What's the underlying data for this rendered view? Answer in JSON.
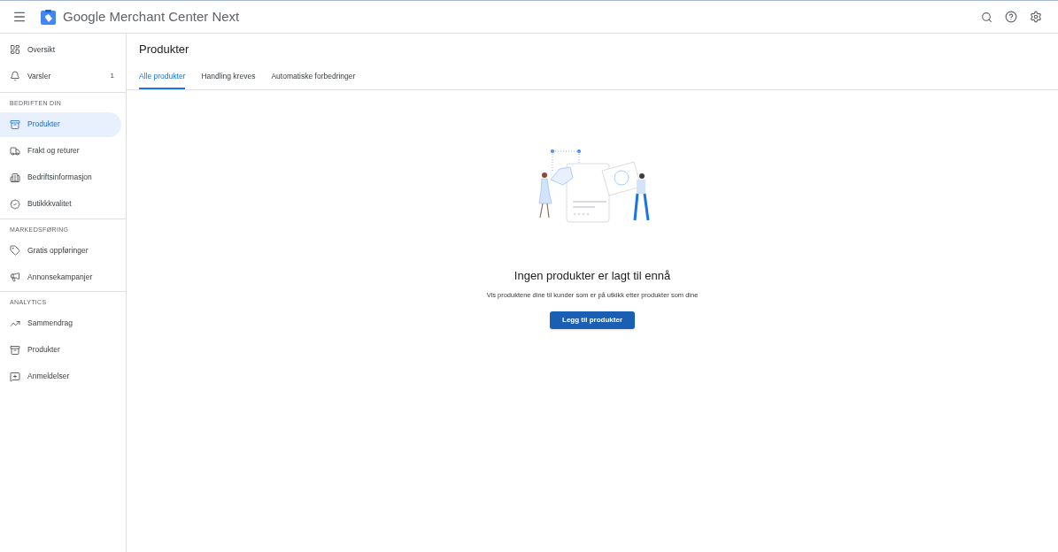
{
  "header": {
    "title": "Google Merchant Center Next"
  },
  "sidebar": {
    "sections": [
      {
        "items": [
          {
            "label": "Oversikt",
            "selected": false
          },
          {
            "label": "Varsler",
            "badge": "1",
            "selected": false
          }
        ]
      },
      {
        "heading": "BEDRIFTEN DIN",
        "items": [
          {
            "label": "Produkter",
            "selected": true
          },
          {
            "label": "Frakt og returer",
            "selected": false
          },
          {
            "label": "Bedriftsinformasjon",
            "selected": false
          },
          {
            "label": "Butikkkvalitet",
            "selected": false
          }
        ]
      },
      {
        "heading": "MARKEDSFØRING",
        "items": [
          {
            "label": "Gratis oppføringer",
            "selected": false
          },
          {
            "label": "Annonsekampanjer",
            "selected": false
          }
        ]
      },
      {
        "heading": "ANALYTICS",
        "items": [
          {
            "label": "Sammendrag",
            "selected": false
          },
          {
            "label": "Produkter",
            "selected": false
          },
          {
            "label": "Anmeldelser",
            "selected": false
          }
        ]
      }
    ]
  },
  "page": {
    "title": "Produkter",
    "tabs": [
      {
        "label": "Alle produkter",
        "selected": true
      },
      {
        "label": "Handling kreves",
        "selected": false
      },
      {
        "label": "Automatiske forbedringer",
        "selected": false
      }
    ]
  },
  "empty_state": {
    "title": "Ingen produkter er lagt til ennå",
    "description": "Vis produktene dine til kunder som er på utkikk etter produkter som dine",
    "button": "Legg til produkter"
  }
}
